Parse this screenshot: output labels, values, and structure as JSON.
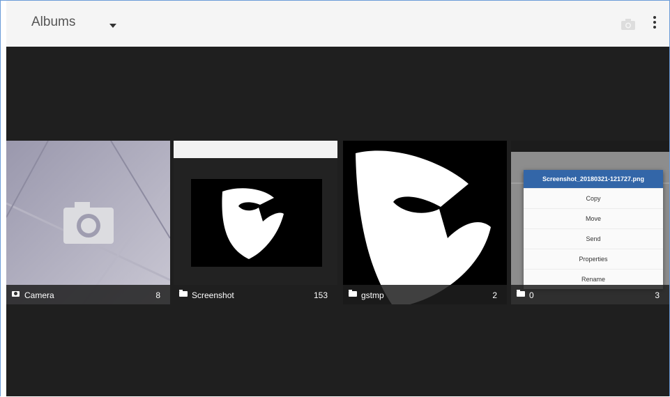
{
  "app_bar": {
    "title": "Albums",
    "dropdown_icon": "caret-down-icon",
    "camera_icon": "camera-icon",
    "more_icon": "more-vert-icon"
  },
  "albums": [
    {
      "name": "Camera",
      "count": "8",
      "icon": "camera-icon"
    },
    {
      "name": "Screenshot",
      "count": "153",
      "icon": "folder-icon"
    },
    {
      "name": "gstmp",
      "count": "2",
      "icon": "folder-icon"
    },
    {
      "name": "0",
      "count": "3",
      "icon": "folder-icon"
    }
  ],
  "thumbnail_context_menu": {
    "title": "Screenshot_20180321-121727.png",
    "items": [
      "Copy",
      "Move",
      "Send",
      "Properties",
      "Rename"
    ]
  },
  "colors": {
    "app_bar_bg": "#f5f5f5",
    "content_bg": "#1f1f1f",
    "menu_header": "#3366a8"
  }
}
